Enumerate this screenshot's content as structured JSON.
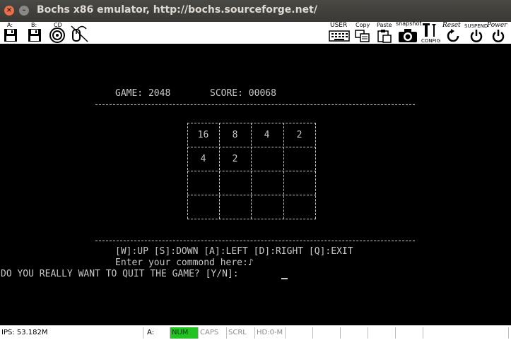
{
  "window": {
    "title": "Bochs x86 emulator, http://bochs.sourceforge.net/",
    "close_glyph": "×",
    "minimize_glyph": "–"
  },
  "toolbar": {
    "floppy_a_label": "A:",
    "floppy_b_label": "B:",
    "cdrom_label": "CD",
    "user_label": "USER",
    "copy_label": "Copy",
    "paste_label": "Paste",
    "snapshot_label": "snapshot",
    "config_label": "CONFIG",
    "reset_label": "Reset",
    "suspend_label": "SUSPEND",
    "power_label": "Power"
  },
  "screen": {
    "game_line": "GAME: 2048",
    "score_line": "SCORE: 00068",
    "board": [
      [
        "16",
        "8",
        "4",
        "2"
      ],
      [
        "4",
        "2",
        "",
        ""
      ],
      [
        "",
        "",
        "",
        ""
      ],
      [
        "",
        "",
        "",
        ""
      ]
    ],
    "controls_line": "[W]:UP [S]:DOWN [A]:LEFT [D]:RIGHT [Q]:EXIT",
    "prompt_line": "Enter your commond here:♪",
    "quit_line": "DO YOU REALLY WANT TO QUIT THE GAME? [Y/N]:"
  },
  "statusbar": {
    "ips": "IPS: 53.182M",
    "drive": "A:",
    "num": "NUM",
    "caps": "CAPS",
    "scrl": "SCRL",
    "hd": "HD:0-M"
  },
  "colors": {
    "titlebar": "#3c3b37",
    "screen_bg": "#000000",
    "screen_text": "#c8c8c8",
    "num_active": "#22c322",
    "close_button": "#e8704a"
  },
  "icons": [
    "floppy-icon",
    "cdrom-icon",
    "keyboard-icon",
    "copy-icon",
    "paste-icon",
    "camera-icon",
    "config-icon",
    "reset-icon",
    "suspend-icon",
    "power-icon"
  ]
}
